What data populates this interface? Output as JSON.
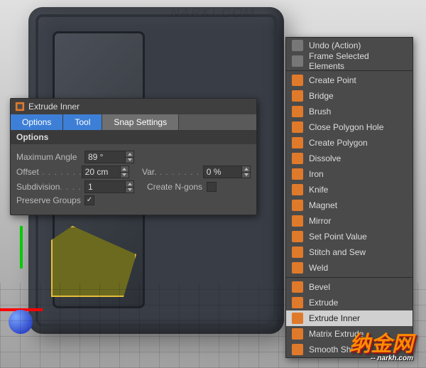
{
  "watermark_top": "NARKI.COM",
  "watermark": {
    "big": "纳金网",
    "small": "-- narkh.com"
  },
  "panel": {
    "title": "Extrude Inner",
    "tabs": [
      "Options",
      "Tool",
      "Snap Settings"
    ],
    "section": "Options",
    "fields": {
      "max_angle_label": "Maximum Angle",
      "max_angle_value": "89 °",
      "offset_label": "Offset",
      "offset_value": "20 cm",
      "var_label": "Var.",
      "var_value": "0 %",
      "subdivision_label": "Subdivision",
      "subdivision_value": "1",
      "create_ngons_label": "Create N-gons",
      "preserve_groups_label": "Preserve Groups"
    }
  },
  "context_menu": {
    "items": [
      {
        "icon": "undo-icon",
        "label": "Undo (Action)",
        "style": "gray"
      },
      {
        "icon": "frame-icon",
        "label": "Frame Selected Elements",
        "style": "gray"
      },
      {
        "sep": true
      },
      {
        "icon": "point-icon",
        "label": "Create Point",
        "style": "orange"
      },
      {
        "icon": "bridge-icon",
        "label": "Bridge",
        "style": "orange"
      },
      {
        "icon": "brush-icon",
        "label": "Brush",
        "style": "orange"
      },
      {
        "icon": "close-poly-icon",
        "label": "Close Polygon Hole",
        "style": "orange"
      },
      {
        "icon": "create-poly-icon",
        "label": "Create Polygon",
        "style": "orange"
      },
      {
        "icon": "dissolve-icon",
        "label": "Dissolve",
        "style": "orange"
      },
      {
        "icon": "iron-icon",
        "label": "Iron",
        "style": "orange"
      },
      {
        "icon": "knife-icon",
        "label": "Knife",
        "style": "orange"
      },
      {
        "icon": "magnet-icon",
        "label": "Magnet",
        "style": "orange"
      },
      {
        "icon": "mirror-icon",
        "label": "Mirror",
        "style": "orange"
      },
      {
        "icon": "set-point-icon",
        "label": "Set Point Value",
        "style": "orange"
      },
      {
        "icon": "stitch-icon",
        "label": "Stitch and Sew",
        "style": "orange"
      },
      {
        "icon": "weld-icon",
        "label": "Weld",
        "style": "orange"
      },
      {
        "sep": true
      },
      {
        "icon": "bevel-icon",
        "label": "Bevel",
        "style": "orange"
      },
      {
        "icon": "extrude-icon",
        "label": "Extrude",
        "style": "orange"
      },
      {
        "icon": "extrude-inner-icon",
        "label": "Extrude Inner",
        "style": "orange",
        "selected": true
      },
      {
        "icon": "matrix-extrude-icon",
        "label": "Matrix Extrude",
        "style": "orange"
      },
      {
        "icon": "smooth-shift-icon",
        "label": "Smooth Shift",
        "style": "orange"
      }
    ]
  }
}
